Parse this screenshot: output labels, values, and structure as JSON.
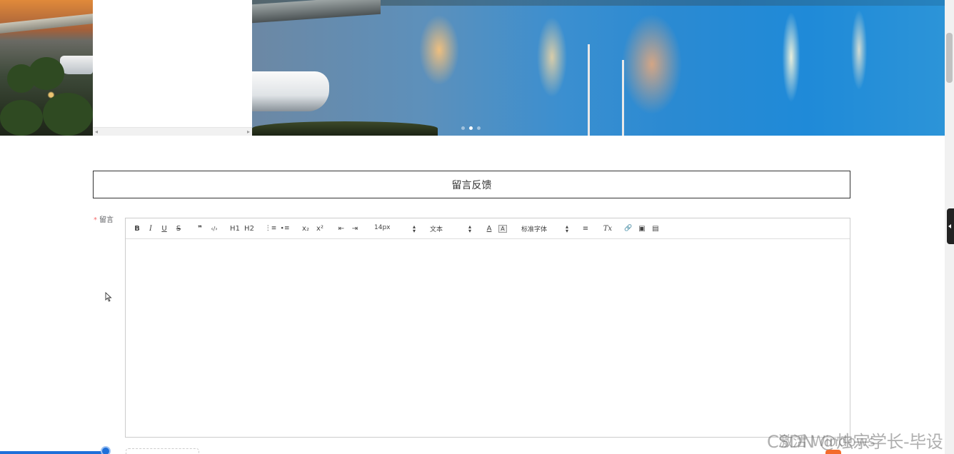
{
  "feedback": {
    "title": "留言反馈",
    "field_label": "留言",
    "required_mark": "*"
  },
  "toolbar": {
    "bold": "B",
    "italic": "I",
    "underline": "U",
    "strike": "S",
    "blockquote": "❞",
    "code": "‹/›",
    "h1": "H1",
    "h2": "H2",
    "ordered_list": "⋮≡",
    "bullet_list": "∙≡",
    "subscript": "x₂",
    "superscript": "x²",
    "indent_decrease": "⇤",
    "indent_increase": "⇥",
    "size_value": "14px",
    "header_value": "文本",
    "color": "A",
    "background": "A",
    "font_value": "标准字体",
    "align": "≡",
    "clean": "Tx",
    "link": "🔗",
    "image": "▣",
    "video": "▤"
  },
  "carousel": {
    "dots": 3,
    "active_dot": 2
  },
  "watermark": "CSDN @烛宗学长-毕设",
  "os_overlay": "激活 Windows",
  "colors": {
    "accent": "#1e6fd9",
    "required": "#f56c6c",
    "border": "#333333"
  }
}
